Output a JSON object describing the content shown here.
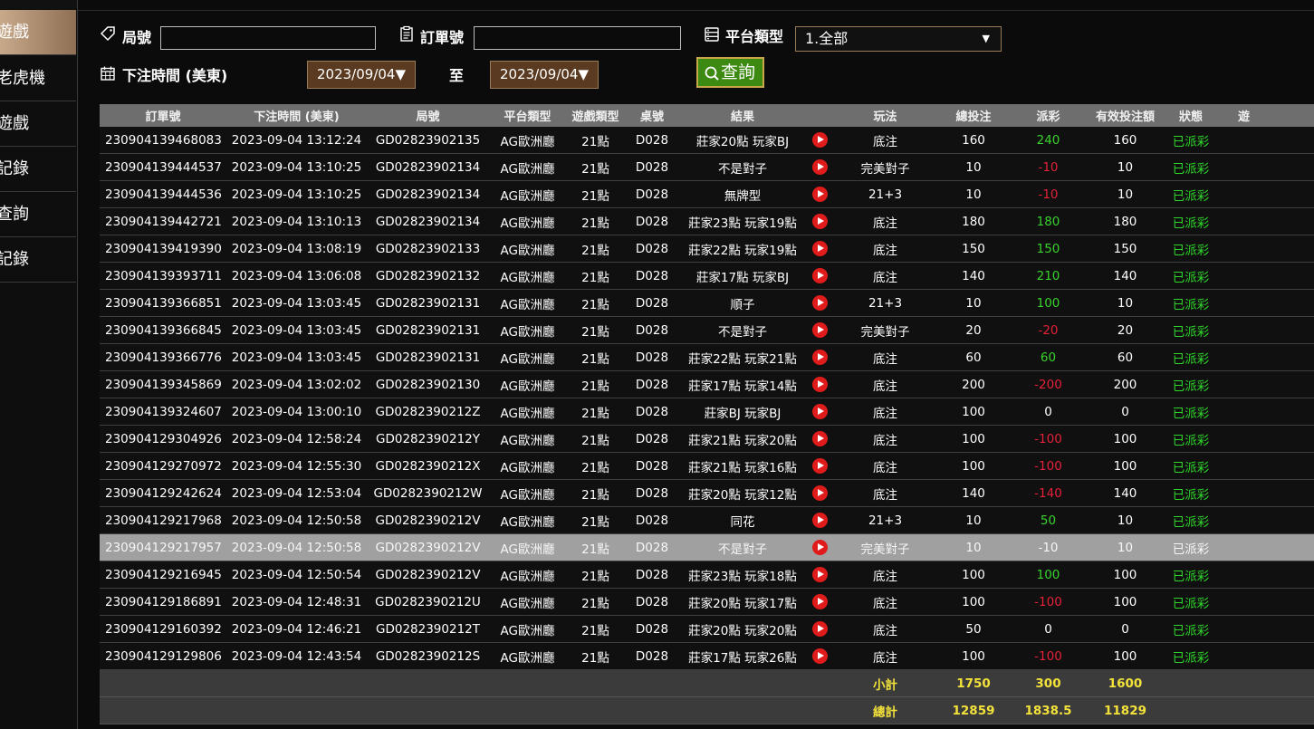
{
  "sidebar": {
    "items": [
      {
        "label": "遊戲",
        "active": true
      },
      {
        "label": "老虎機",
        "active": false
      },
      {
        "label": "遊戲",
        "active": false
      },
      {
        "label": "記錄",
        "active": false
      },
      {
        "label": "查詢",
        "active": false
      },
      {
        "label": "記錄",
        "active": false
      }
    ]
  },
  "filters": {
    "round_label": "局號",
    "round_value": "",
    "order_label": "訂單號",
    "order_value": "",
    "platform_label": "平台類型",
    "platform_selected": "1.全部",
    "time_label": "下注時間 (美東)",
    "date_from": "2023/09/04▼",
    "to_label": "至",
    "date_to": "2023/09/04▼",
    "query_label": "查詢"
  },
  "table": {
    "headers": [
      "訂單號",
      "下注時間 (美東)",
      "局號",
      "平台類型",
      "遊戲類型",
      "桌號",
      "結果",
      "",
      "玩法",
      "總投注",
      "派彩",
      "有效投注額",
      "狀態",
      "遊"
    ],
    "rows": [
      {
        "order": "230904139468083",
        "time": "2023-09-04 13:12:24",
        "round": "GD02823902135",
        "platform": "AG歐洲廳",
        "game": "21點",
        "table": "D028",
        "result": "莊家20點 玩家BJ",
        "mode": "底注",
        "bet": "160",
        "payout": "240",
        "payout_sign": "pos",
        "valid": "160",
        "status": "已派彩"
      },
      {
        "order": "230904139444537",
        "time": "2023-09-04 13:10:25",
        "round": "GD02823902134",
        "platform": "AG歐洲廳",
        "game": "21點",
        "table": "D028",
        "result": "不是對子",
        "mode": "完美對子",
        "bet": "10",
        "payout": "-10",
        "payout_sign": "neg",
        "valid": "10",
        "status": "已派彩"
      },
      {
        "order": "230904139444536",
        "time": "2023-09-04 13:10:25",
        "round": "GD02823902134",
        "platform": "AG歐洲廳",
        "game": "21點",
        "table": "D028",
        "result": "無牌型",
        "mode": "21+3",
        "bet": "10",
        "payout": "-10",
        "payout_sign": "neg",
        "valid": "10",
        "status": "已派彩"
      },
      {
        "order": "230904139442721",
        "time": "2023-09-04 13:10:13",
        "round": "GD02823902134",
        "platform": "AG歐洲廳",
        "game": "21點",
        "table": "D028",
        "result": "莊家23點 玩家19點",
        "mode": "底注",
        "bet": "180",
        "payout": "180",
        "payout_sign": "pos",
        "valid": "180",
        "status": "已派彩"
      },
      {
        "order": "230904139419390",
        "time": "2023-09-04 13:08:19",
        "round": "GD02823902133",
        "platform": "AG歐洲廳",
        "game": "21點",
        "table": "D028",
        "result": "莊家22點 玩家19點",
        "mode": "底注",
        "bet": "150",
        "payout": "150",
        "payout_sign": "pos",
        "valid": "150",
        "status": "已派彩"
      },
      {
        "order": "230904139393711",
        "time": "2023-09-04 13:06:08",
        "round": "GD02823902132",
        "platform": "AG歐洲廳",
        "game": "21點",
        "table": "D028",
        "result": "莊家17點 玩家BJ",
        "mode": "底注",
        "bet": "140",
        "payout": "210",
        "payout_sign": "pos",
        "valid": "140",
        "status": "已派彩"
      },
      {
        "order": "230904139366851",
        "time": "2023-09-04 13:03:45",
        "round": "GD02823902131",
        "platform": "AG歐洲廳",
        "game": "21點",
        "table": "D028",
        "result": "順子",
        "mode": "21+3",
        "bet": "10",
        "payout": "100",
        "payout_sign": "pos",
        "valid": "10",
        "status": "已派彩"
      },
      {
        "order": "230904139366845",
        "time": "2023-09-04 13:03:45",
        "round": "GD02823902131",
        "platform": "AG歐洲廳",
        "game": "21點",
        "table": "D028",
        "result": "不是對子",
        "mode": "完美對子",
        "bet": "20",
        "payout": "-20",
        "payout_sign": "neg",
        "valid": "20",
        "status": "已派彩"
      },
      {
        "order": "230904139366776",
        "time": "2023-09-04 13:03:45",
        "round": "GD02823902131",
        "platform": "AG歐洲廳",
        "game": "21點",
        "table": "D028",
        "result": "莊家22點 玩家21點",
        "mode": "底注",
        "bet": "60",
        "payout": "60",
        "payout_sign": "pos",
        "valid": "60",
        "status": "已派彩"
      },
      {
        "order": "230904139345869",
        "time": "2023-09-04 13:02:02",
        "round": "GD02823902130",
        "platform": "AG歐洲廳",
        "game": "21點",
        "table": "D028",
        "result": "莊家17點 玩家14點",
        "mode": "底注",
        "bet": "200",
        "payout": "-200",
        "payout_sign": "neg",
        "valid": "200",
        "status": "已派彩"
      },
      {
        "order": "230904139324607",
        "time": "2023-09-04 13:00:10",
        "round": "GD0282390212Z",
        "platform": "AG歐洲廳",
        "game": "21點",
        "table": "D028",
        "result": "莊家BJ 玩家BJ",
        "mode": "底注",
        "bet": "100",
        "payout": "0",
        "payout_sign": "zero",
        "valid": "0",
        "status": "已派彩"
      },
      {
        "order": "230904129304926",
        "time": "2023-09-04 12:58:24",
        "round": "GD0282390212Y",
        "platform": "AG歐洲廳",
        "game": "21點",
        "table": "D028",
        "result": "莊家21點 玩家20點",
        "mode": "底注",
        "bet": "100",
        "payout": "-100",
        "payout_sign": "neg",
        "valid": "100",
        "status": "已派彩"
      },
      {
        "order": "230904129270972",
        "time": "2023-09-04 12:55:30",
        "round": "GD0282390212X",
        "platform": "AG歐洲廳",
        "game": "21點",
        "table": "D028",
        "result": "莊家21點 玩家16點",
        "mode": "底注",
        "bet": "100",
        "payout": "-100",
        "payout_sign": "neg",
        "valid": "100",
        "status": "已派彩"
      },
      {
        "order": "230904129242624",
        "time": "2023-09-04 12:53:04",
        "round": "GD0282390212W",
        "platform": "AG歐洲廳",
        "game": "21點",
        "table": "D028",
        "result": "莊家20點 玩家12點",
        "mode": "底注",
        "bet": "140",
        "payout": "-140",
        "payout_sign": "neg",
        "valid": "140",
        "status": "已派彩"
      },
      {
        "order": "230904129217968",
        "time": "2023-09-04 12:50:58",
        "round": "GD0282390212V",
        "platform": "AG歐洲廳",
        "game": "21點",
        "table": "D028",
        "result": "同花",
        "mode": "21+3",
        "bet": "10",
        "payout": "50",
        "payout_sign": "pos",
        "valid": "10",
        "status": "已派彩"
      },
      {
        "order": "230904129217957",
        "time": "2023-09-04 12:50:58",
        "round": "GD0282390212V",
        "platform": "AG歐洲廳",
        "game": "21點",
        "table": "D028",
        "result": "不是對子",
        "mode": "完美對子",
        "bet": "10",
        "payout": "-10",
        "payout_sign": "neg",
        "valid": "10",
        "status": "已派彩",
        "highlight": true
      },
      {
        "order": "230904129216945",
        "time": "2023-09-04 12:50:54",
        "round": "GD0282390212V",
        "platform": "AG歐洲廳",
        "game": "21點",
        "table": "D028",
        "result": "莊家23點 玩家18點",
        "mode": "底注",
        "bet": "100",
        "payout": "100",
        "payout_sign": "pos",
        "valid": "100",
        "status": "已派彩"
      },
      {
        "order": "230904129186891",
        "time": "2023-09-04 12:48:31",
        "round": "GD0282390212U",
        "platform": "AG歐洲廳",
        "game": "21點",
        "table": "D028",
        "result": "莊家20點 玩家17點",
        "mode": "底注",
        "bet": "100",
        "payout": "-100",
        "payout_sign": "neg",
        "valid": "100",
        "status": "已派彩"
      },
      {
        "order": "230904129160392",
        "time": "2023-09-04 12:46:21",
        "round": "GD0282390212T",
        "platform": "AG歐洲廳",
        "game": "21點",
        "table": "D028",
        "result": "莊家20點 玩家20點",
        "mode": "底注",
        "bet": "50",
        "payout": "0",
        "payout_sign": "zero",
        "valid": "0",
        "status": "已派彩"
      },
      {
        "order": "230904129129806",
        "time": "2023-09-04 12:43:54",
        "round": "GD0282390212S",
        "platform": "AG歐洲廳",
        "game": "21點",
        "table": "D028",
        "result": "莊家17點 玩家26點",
        "mode": "底注",
        "bet": "100",
        "payout": "-100",
        "payout_sign": "neg",
        "valid": "100",
        "status": "已派彩"
      }
    ],
    "subtotal": {
      "label": "小計",
      "bet": "1750",
      "payout": "300",
      "valid": "1600"
    },
    "total": {
      "label": "總計",
      "bet": "12859",
      "payout": "1838.5",
      "valid": "11829"
    }
  },
  "colors": {
    "positive": "#39d32d",
    "negative": "#e5213a",
    "status": "#2fd62a",
    "summary": "#f2e23a",
    "accent": "#c8a98a"
  },
  "icons": {
    "round": "tag-icon",
    "order": "clipboard-icon",
    "platform": "server-icon",
    "time": "calendar-icon",
    "query": "search-icon",
    "result_video": "play-video-icon"
  }
}
